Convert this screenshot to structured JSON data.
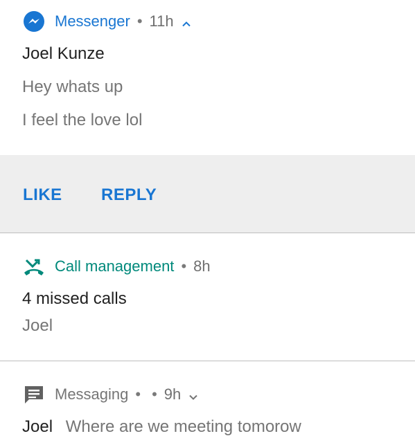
{
  "notifications": [
    {
      "app_name": "Messenger",
      "time": "11h",
      "title": "Joel Kunze",
      "lines": [
        "Hey whats up",
        "I feel the love lol"
      ],
      "actions": [
        "LIKE",
        "REPLY"
      ],
      "accent": "#1976d2",
      "icon": "messenger-icon",
      "chevron": "chevron-up-icon"
    },
    {
      "app_name": "Call management",
      "time": "8h",
      "title": "4 missed calls",
      "lines": [
        "Joel"
      ],
      "accent": "#00897b",
      "icon": "missed-call-icon"
    },
    {
      "app_name": "Messaging",
      "separator_extra": "•",
      "time": "9h",
      "sender": "Joel",
      "preview": "Where are we meeting tomorow",
      "accent": "#757575",
      "icon": "message-icon",
      "chevron": "chevron-down-icon"
    }
  ],
  "colors": {
    "background": "#ffffff",
    "action_bar": "#eeeeee",
    "divider": "#bdbdbd",
    "title": "#212121",
    "body": "#757575"
  }
}
